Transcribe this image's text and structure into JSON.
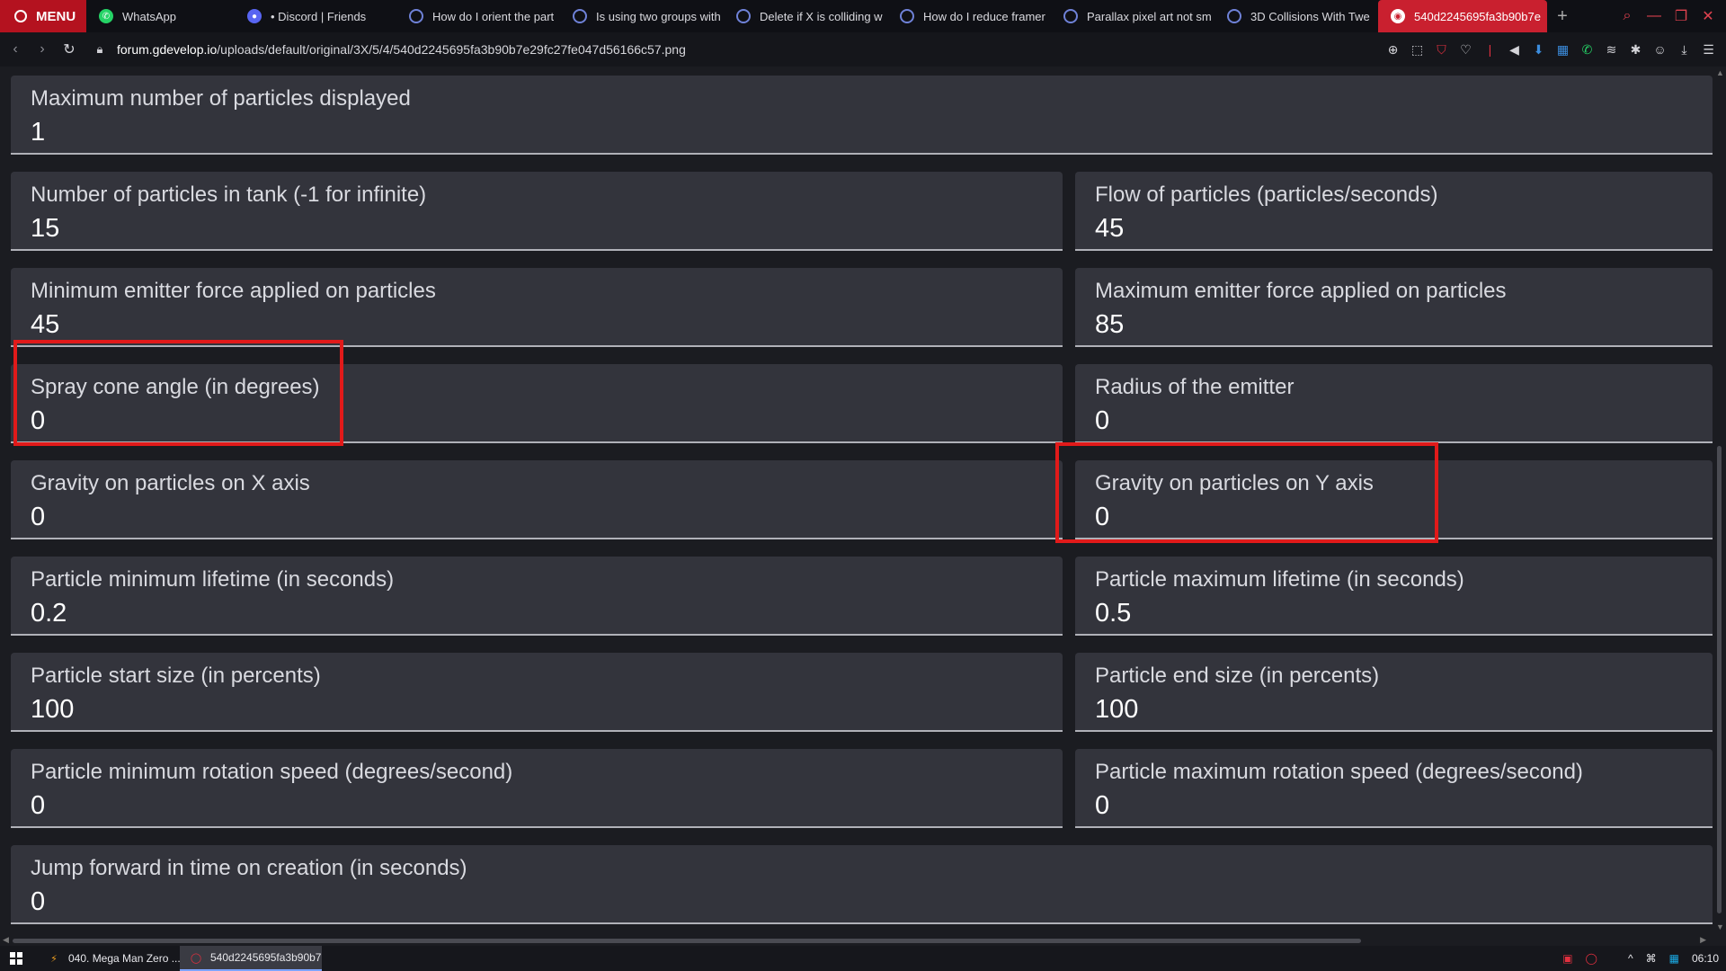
{
  "browser": {
    "menu_label": "MENU",
    "tabs": [
      {
        "title": "WhatsApp",
        "icon": "whatsapp-icon"
      },
      {
        "title": "• Discord | Friends",
        "icon": "discord-icon"
      },
      {
        "title": "How do I orient the part",
        "icon": "gdevelop-icon"
      },
      {
        "title": "Is using two groups with",
        "icon": "gdevelop-icon"
      },
      {
        "title": "Delete if X is colliding w",
        "icon": "gdevelop-icon"
      },
      {
        "title": "How do I reduce framer",
        "icon": "gdevelop-icon"
      },
      {
        "title": "Parallax pixel art not sm",
        "icon": "gdevelop-icon"
      },
      {
        "title": "3D Collisions With Twe",
        "icon": "gdevelop-icon"
      },
      {
        "title": "540d2245695fa3b90b7e",
        "icon": "opera-icon"
      }
    ],
    "url_domain": "forum.gdevelop.io",
    "url_path": "/uploads/default/original/3X/5/4/540d2245695fa3b90b7e29fc27fe047d56166c57.png"
  },
  "fields": {
    "max_displayed": {
      "label": "Maximum number of particles displayed",
      "value": "1"
    },
    "tank": {
      "label": "Number of particles in tank (-1 for infinite)",
      "value": "15"
    },
    "flow": {
      "label": "Flow of particles (particles/seconds)",
      "value": "45"
    },
    "min_force": {
      "label": "Minimum emitter force applied on particles",
      "value": "45"
    },
    "max_force": {
      "label": "Maximum emitter force applied on particles",
      "value": "85"
    },
    "spray_cone": {
      "label": "Spray cone angle (in degrees)",
      "value": "0"
    },
    "radius": {
      "label": "Radius of the emitter",
      "value": "0"
    },
    "gravity_x": {
      "label": "Gravity on particles on X axis",
      "value": "0"
    },
    "gravity_y": {
      "label": "Gravity on particles on Y axis",
      "value": "0"
    },
    "min_lifetime": {
      "label": "Particle minimum lifetime (in seconds)",
      "value": "0.2"
    },
    "max_lifetime": {
      "label": "Particle maximum lifetime (in seconds)",
      "value": "0.5"
    },
    "start_size": {
      "label": "Particle start size (in percents)",
      "value": "100"
    },
    "end_size": {
      "label": "Particle end size (in percents)",
      "value": "100"
    },
    "min_rotation": {
      "label": "Particle minimum rotation speed (degrees/second)",
      "value": "0"
    },
    "max_rotation": {
      "label": "Particle maximum rotation speed (degrees/second)",
      "value": "0"
    },
    "jump_forward": {
      "label": "Jump forward in time on creation (in seconds)",
      "value": "0"
    }
  },
  "taskbar": {
    "tasks": [
      {
        "title": "040. Mega Man Zero ...",
        "icon": "winamp-icon"
      },
      {
        "title": "540d2245695fa3b90b7...",
        "icon": "opera-icon"
      }
    ],
    "clock": "06:10"
  },
  "colors": {
    "highlight": "#e11a1a",
    "active_tab": "#c9202f",
    "field_bg": "#33343c"
  }
}
